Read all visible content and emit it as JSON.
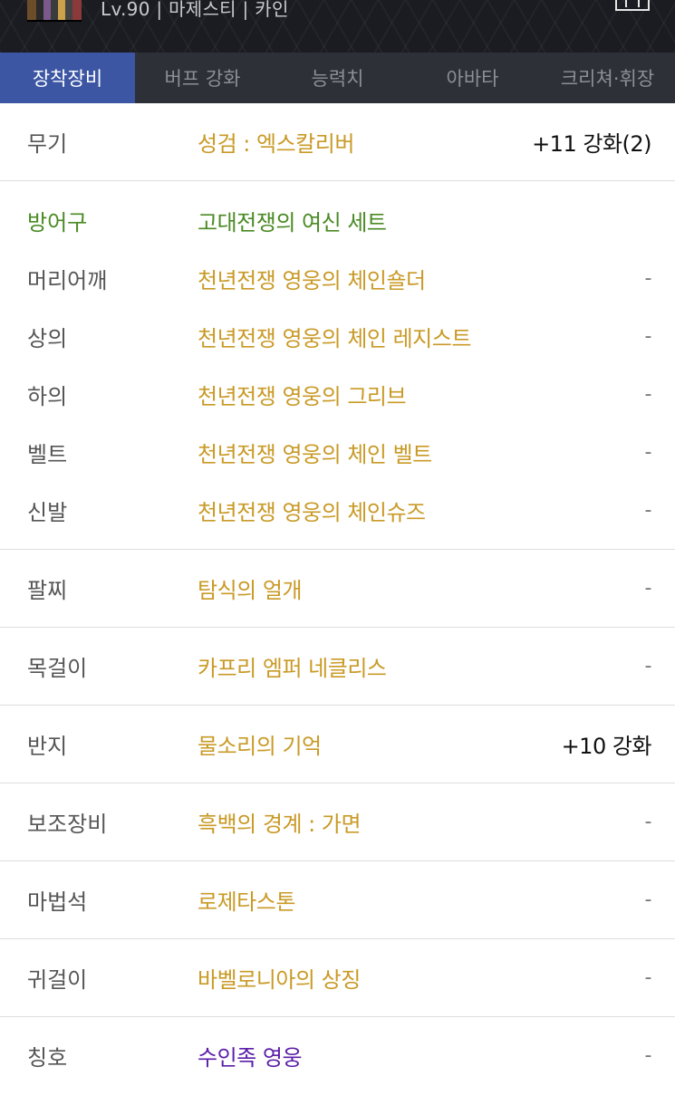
{
  "header": {
    "character_info": "Lv.90 | 마제스티 | 카인",
    "thumbnail_icon": "character-thumbnail",
    "menu_icon": "menu-icon"
  },
  "tabs": [
    {
      "label": "장착장비",
      "active": true
    },
    {
      "label": "버프 강화",
      "active": false
    },
    {
      "label": "능력치",
      "active": false
    },
    {
      "label": "아바타",
      "active": false
    },
    {
      "label": "크리쳐·휘장",
      "active": false
    }
  ],
  "colors": {
    "unique": "#c99a26",
    "set": "#4a8a24",
    "epic_title": "#5b1ea8",
    "tab_active": "#3c56a4"
  },
  "equipment": {
    "weapon": {
      "slot": "무기",
      "name": "성검 : 엑스칼리버",
      "value": "+11 강화(2)"
    },
    "armor_set": {
      "slot": "방어구",
      "name": "고대전쟁의 여신 세트"
    },
    "armor": [
      {
        "slot": "머리어깨",
        "name": "천년전쟁 영웅의 체인숄더",
        "value": "-"
      },
      {
        "slot": "상의",
        "name": "천년전쟁 영웅의 체인 레지스트",
        "value": "-"
      },
      {
        "slot": "하의",
        "name": "천년전쟁 영웅의 그리브",
        "value": "-"
      },
      {
        "slot": "벨트",
        "name": "천년전쟁 영웅의 체인 벨트",
        "value": "-"
      },
      {
        "slot": "신발",
        "name": "천년전쟁 영웅의 체인슈즈",
        "value": "-"
      }
    ],
    "others": [
      {
        "slot": "팔찌",
        "name": "탐식의 얼개",
        "value": "-"
      },
      {
        "slot": "목걸이",
        "name": "카프리 엠퍼 네클리스",
        "value": "-"
      },
      {
        "slot": "반지",
        "name": "물소리의 기억",
        "value": "+10 강화"
      },
      {
        "slot": "보조장비",
        "name": "흑백의 경계 : 가면",
        "value": "-"
      },
      {
        "slot": "마법석",
        "name": "로제타스톤",
        "value": "-"
      },
      {
        "slot": "귀걸이",
        "name": "바벨로니아의 상징",
        "value": "-"
      },
      {
        "slot": "칭호",
        "name": "수인족 영웅",
        "value": "-"
      }
    ]
  }
}
